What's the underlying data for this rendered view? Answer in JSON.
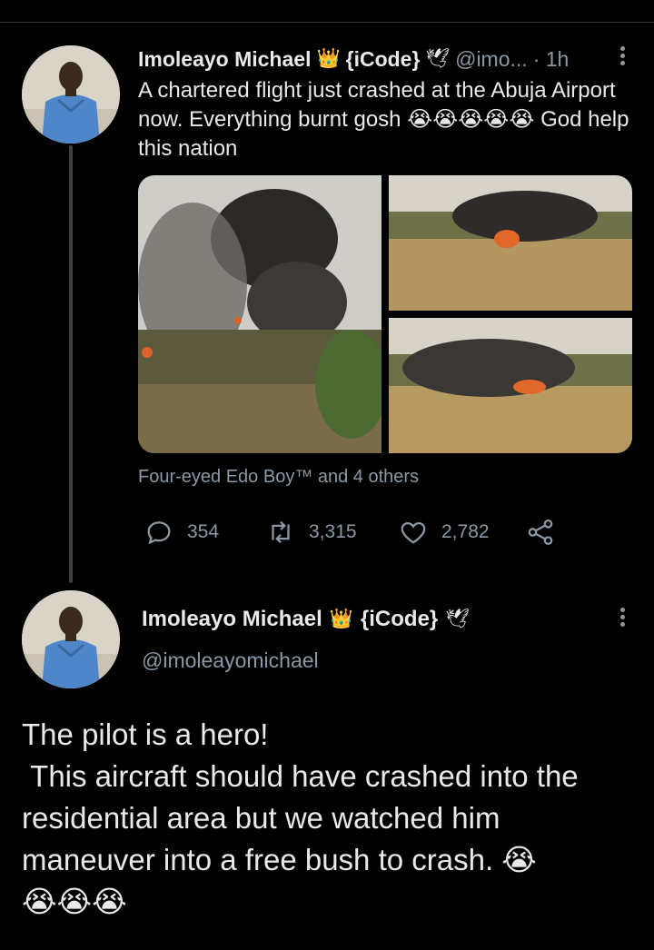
{
  "tweet1": {
    "author_name": "Imoleayo Michael",
    "crown_emoji": "👑",
    "name_suffix": "{iCode}",
    "dove_emoji": "🕊",
    "handle": "@imo...",
    "time": "· 1h",
    "text": "A chartered flight just crashed at the Abuja Airport now. Everything burnt gosh 😭😭😭😭😭 God help this nation",
    "tagged": "Four-eyed Edo Boy™ and 4 others",
    "replies": "354",
    "retweets": "3,315",
    "likes": "2,782"
  },
  "tweet2": {
    "author_name": "Imoleayo Michael",
    "crown_emoji": "👑",
    "name_suffix": "{iCode}",
    "dove_emoji": "🕊",
    "handle": "@imoleayomichael",
    "text": "The pilot is a hero!\n This aircraft should have crashed into the residential area but we watched him maneuver into a free bush to crash. 😭\n😭😭😭"
  },
  "icons": {
    "reply": "reply-icon",
    "retweet": "retweet-icon",
    "like": "heart-icon",
    "share": "share-icon",
    "more": "more-vertical-icon"
  },
  "colors": {
    "background": "#000000",
    "text": "#e7e9ea",
    "muted": "#8b98a5",
    "thread_line": "#3e4144"
  }
}
